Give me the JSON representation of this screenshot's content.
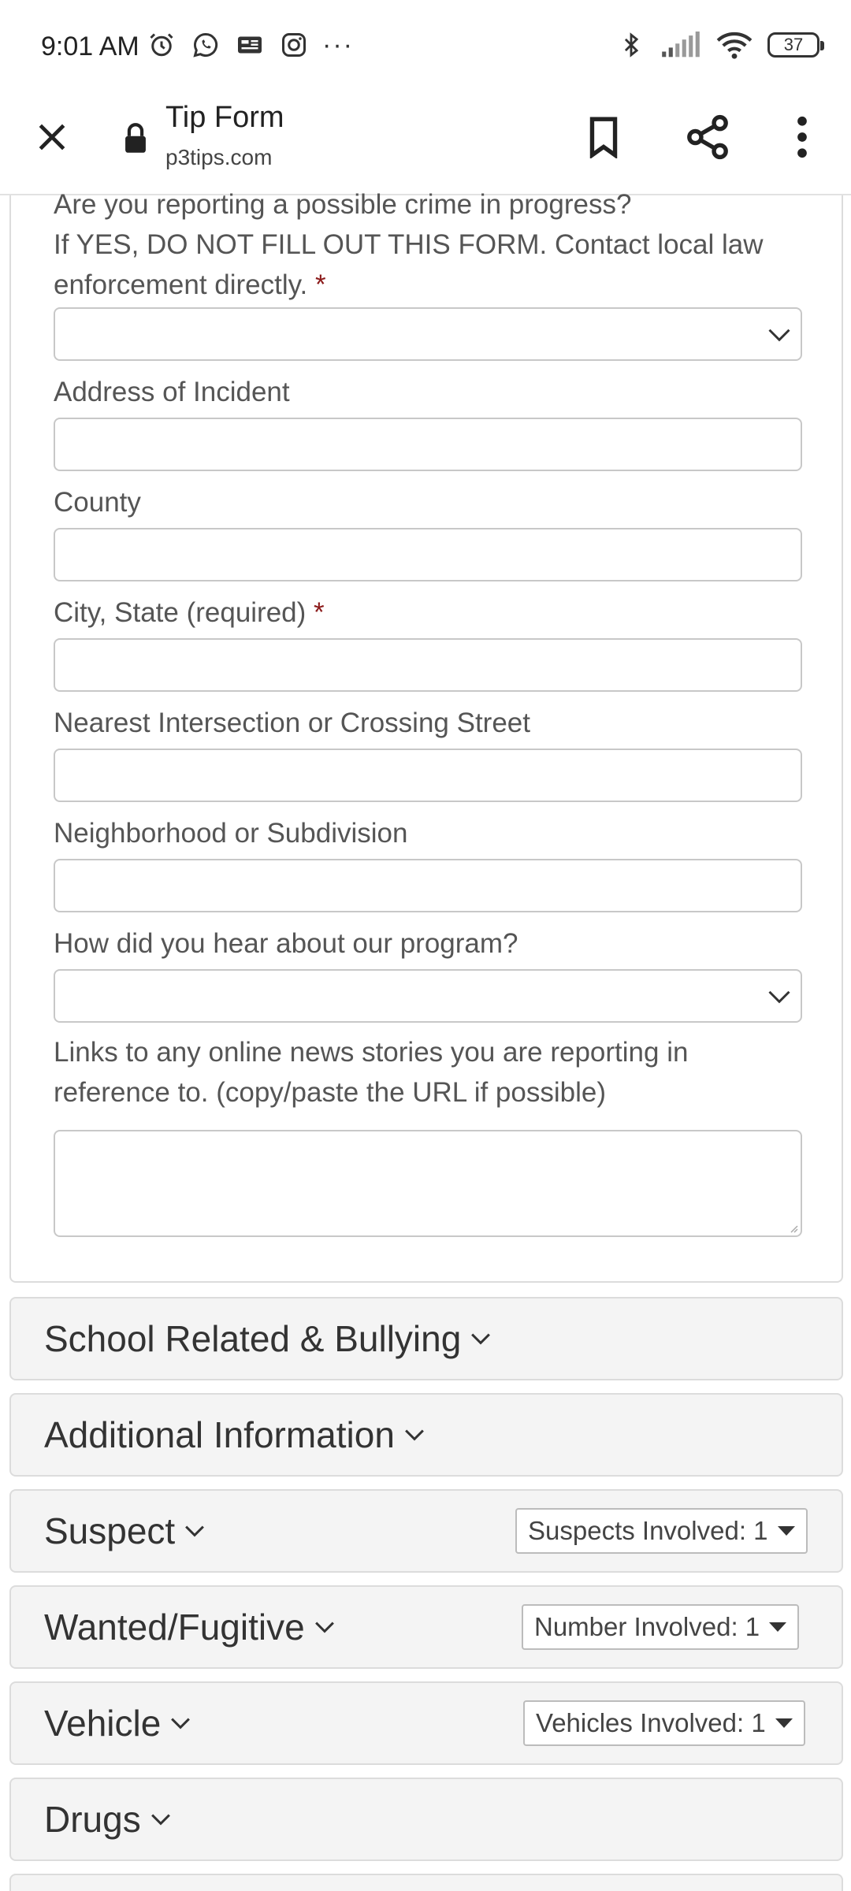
{
  "status_bar": {
    "time": "9:01 AM",
    "left_icons": [
      "alarm-icon",
      "whatsapp-icon",
      "news-icon",
      "instagram-icon",
      "more-dots-icon"
    ],
    "more_label": "···",
    "right_icons": [
      "bluetooth-icon",
      "signal-icon",
      "wifi-icon"
    ],
    "battery": "37"
  },
  "toolbar": {
    "page_title": "Tip Form",
    "url": "p3tips.com"
  },
  "form": {
    "crime_question_line1": "Are you reporting a possible crime in progress?",
    "crime_question_line2": "If YES, DO NOT FILL OUT THIS FORM. Contact local law",
    "crime_question_line3": "enforcement directly.",
    "required_mark": "*",
    "crime_select_value": "",
    "address_label": "Address of Incident",
    "address_value": "",
    "county_label": "County",
    "county_value": "",
    "city_state_label": "City, State (required)",
    "city_state_value": "",
    "intersection_label": "Nearest Intersection or Crossing Street",
    "intersection_value": "",
    "neighborhood_label": "Neighborhood or Subdivision",
    "neighborhood_value": "",
    "heard_label": "How did you hear about our program?",
    "heard_value": "",
    "links_label_line1": "Links to any online news stories you are reporting in",
    "links_label_line2": "reference to. (copy/paste the URL if possible)",
    "links_value": ""
  },
  "sections": {
    "school": {
      "title": "School Related & Bullying"
    },
    "additional": {
      "title": "Additional Information"
    },
    "suspect": {
      "title": "Suspect",
      "count_label": "Suspects Involved: 1"
    },
    "wanted": {
      "title": "Wanted/Fugitive",
      "count_label": "Number Involved: 1"
    },
    "vehicle": {
      "title": "Vehicle",
      "count_label": "Vehicles Involved: 1"
    },
    "drugs": {
      "title": "Drugs"
    }
  },
  "colors": {
    "required": "#8b1a1a",
    "section_bg": "#f4f4f4",
    "border": "#dcdcdc"
  }
}
